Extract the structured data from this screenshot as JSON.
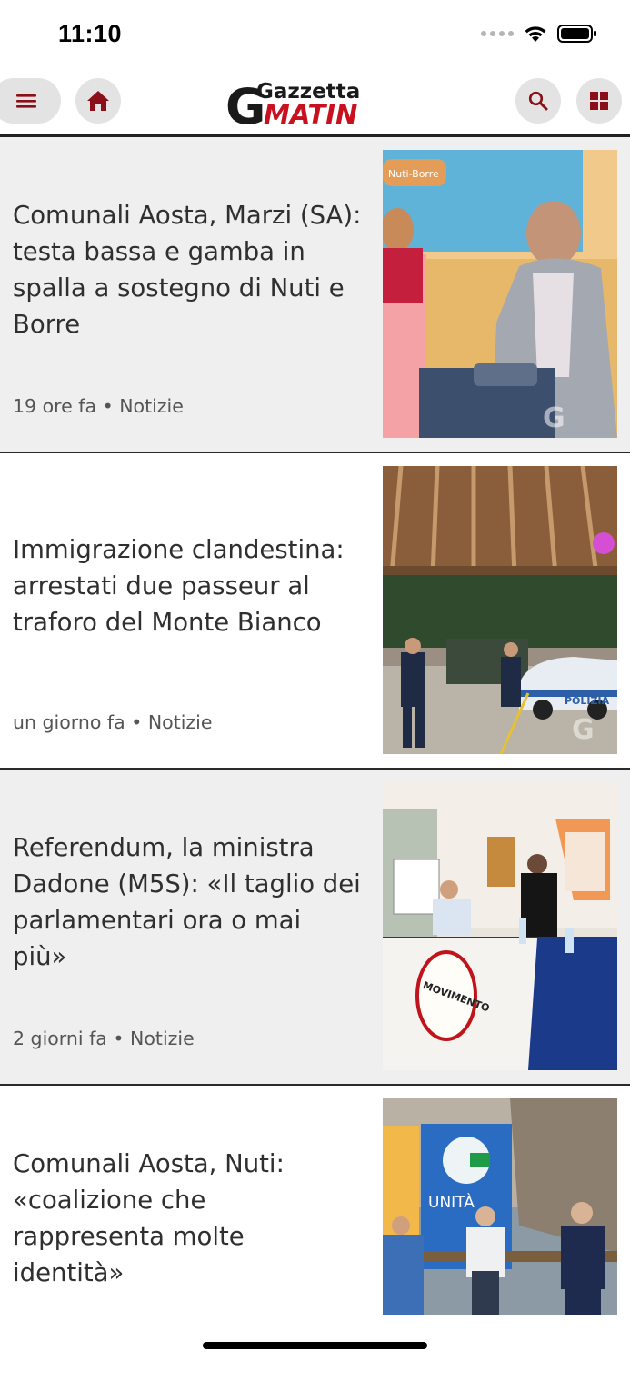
{
  "status_bar": {
    "time": "11:10"
  },
  "header": {
    "logo_top": "Gazzetta",
    "logo_bottom": "MATIN",
    "logo_g": "G"
  },
  "colors": {
    "brand_red": "#b3121f",
    "icon_red": "#8a0f18",
    "button_grey": "#e3e3e3"
  },
  "icons": [
    "menu-icon",
    "home-icon",
    "search-icon",
    "grid-icon"
  ],
  "articles": [
    {
      "title": "Comunali Aosta, Marzi (SA): testa bassa e gamba in spalla a sostegno di Nuti e Borre",
      "age": "19 ore fa",
      "category": "Notizie",
      "image_watermark": "Nuti-Borre"
    },
    {
      "title": "Immigrazione clandestina: arrestati due passeur al traforo del Monte Bianco",
      "age": "un giorno fa",
      "category": "Notizie",
      "image_watermark": "POLIZIA"
    },
    {
      "title": "Referendum, la ministra Dadone (M5S): «Il taglio dei parlamentari ora o mai più»",
      "age": "2 giorni fa",
      "category": "Notizie",
      "image_watermark": "MOVIMENTO"
    },
    {
      "title": "Comunali Aosta, Nuti: «coalizione che rappresenta molte identità»",
      "age": "",
      "category": "",
      "image_watermark": "UNITÀ"
    }
  ],
  "separator": "•"
}
